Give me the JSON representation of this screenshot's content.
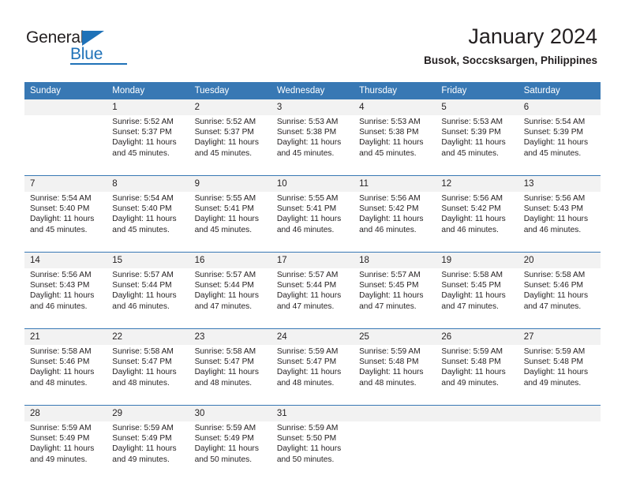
{
  "brand": {
    "name_part1": "General",
    "name_part2": "Blue",
    "triangle_icon": "triangle-icon",
    "accent_color": "#1f72b8"
  },
  "header": {
    "title": "January 2024",
    "subtitle": "Busok, Soccsksargen, Philippines"
  },
  "theme": {
    "header_bg": "#3878b4",
    "daynum_bg": "#f2f2f2",
    "cell_bg": "#ffffff",
    "text_color": "#231f20"
  },
  "calendar": {
    "weekday_headers": [
      "Sunday",
      "Monday",
      "Tuesday",
      "Wednesday",
      "Thursday",
      "Friday",
      "Saturday"
    ],
    "weeks": [
      {
        "daynums": [
          "",
          "1",
          "2",
          "3",
          "4",
          "5",
          "6"
        ],
        "details": [
          {
            "l1": "",
            "l2": "",
            "l3": "",
            "l4": ""
          },
          {
            "l1": "Sunrise: 5:52 AM",
            "l2": "Sunset: 5:37 PM",
            "l3": "Daylight: 11 hours",
            "l4": "and 45 minutes."
          },
          {
            "l1": "Sunrise: 5:52 AM",
            "l2": "Sunset: 5:37 PM",
            "l3": "Daylight: 11 hours",
            "l4": "and 45 minutes."
          },
          {
            "l1": "Sunrise: 5:53 AM",
            "l2": "Sunset: 5:38 PM",
            "l3": "Daylight: 11 hours",
            "l4": "and 45 minutes."
          },
          {
            "l1": "Sunrise: 5:53 AM",
            "l2": "Sunset: 5:38 PM",
            "l3": "Daylight: 11 hours",
            "l4": "and 45 minutes."
          },
          {
            "l1": "Sunrise: 5:53 AM",
            "l2": "Sunset: 5:39 PM",
            "l3": "Daylight: 11 hours",
            "l4": "and 45 minutes."
          },
          {
            "l1": "Sunrise: 5:54 AM",
            "l2": "Sunset: 5:39 PM",
            "l3": "Daylight: 11 hours",
            "l4": "and 45 minutes."
          }
        ]
      },
      {
        "daynums": [
          "7",
          "8",
          "9",
          "10",
          "11",
          "12",
          "13"
        ],
        "details": [
          {
            "l1": "Sunrise: 5:54 AM",
            "l2": "Sunset: 5:40 PM",
            "l3": "Daylight: 11 hours",
            "l4": "and 45 minutes."
          },
          {
            "l1": "Sunrise: 5:54 AM",
            "l2": "Sunset: 5:40 PM",
            "l3": "Daylight: 11 hours",
            "l4": "and 45 minutes."
          },
          {
            "l1": "Sunrise: 5:55 AM",
            "l2": "Sunset: 5:41 PM",
            "l3": "Daylight: 11 hours",
            "l4": "and 45 minutes."
          },
          {
            "l1": "Sunrise: 5:55 AM",
            "l2": "Sunset: 5:41 PM",
            "l3": "Daylight: 11 hours",
            "l4": "and 46 minutes."
          },
          {
            "l1": "Sunrise: 5:56 AM",
            "l2": "Sunset: 5:42 PM",
            "l3": "Daylight: 11 hours",
            "l4": "and 46 minutes."
          },
          {
            "l1": "Sunrise: 5:56 AM",
            "l2": "Sunset: 5:42 PM",
            "l3": "Daylight: 11 hours",
            "l4": "and 46 minutes."
          },
          {
            "l1": "Sunrise: 5:56 AM",
            "l2": "Sunset: 5:43 PM",
            "l3": "Daylight: 11 hours",
            "l4": "and 46 minutes."
          }
        ]
      },
      {
        "daynums": [
          "14",
          "15",
          "16",
          "17",
          "18",
          "19",
          "20"
        ],
        "details": [
          {
            "l1": "Sunrise: 5:56 AM",
            "l2": "Sunset: 5:43 PM",
            "l3": "Daylight: 11 hours",
            "l4": "and 46 minutes."
          },
          {
            "l1": "Sunrise: 5:57 AM",
            "l2": "Sunset: 5:44 PM",
            "l3": "Daylight: 11 hours",
            "l4": "and 46 minutes."
          },
          {
            "l1": "Sunrise: 5:57 AM",
            "l2": "Sunset: 5:44 PM",
            "l3": "Daylight: 11 hours",
            "l4": "and 47 minutes."
          },
          {
            "l1": "Sunrise: 5:57 AM",
            "l2": "Sunset: 5:44 PM",
            "l3": "Daylight: 11 hours",
            "l4": "and 47 minutes."
          },
          {
            "l1": "Sunrise: 5:57 AM",
            "l2": "Sunset: 5:45 PM",
            "l3": "Daylight: 11 hours",
            "l4": "and 47 minutes."
          },
          {
            "l1": "Sunrise: 5:58 AM",
            "l2": "Sunset: 5:45 PM",
            "l3": "Daylight: 11 hours",
            "l4": "and 47 minutes."
          },
          {
            "l1": "Sunrise: 5:58 AM",
            "l2": "Sunset: 5:46 PM",
            "l3": "Daylight: 11 hours",
            "l4": "and 47 minutes."
          }
        ]
      },
      {
        "daynums": [
          "21",
          "22",
          "23",
          "24",
          "25",
          "26",
          "27"
        ],
        "details": [
          {
            "l1": "Sunrise: 5:58 AM",
            "l2": "Sunset: 5:46 PM",
            "l3": "Daylight: 11 hours",
            "l4": "and 48 minutes."
          },
          {
            "l1": "Sunrise: 5:58 AM",
            "l2": "Sunset: 5:47 PM",
            "l3": "Daylight: 11 hours",
            "l4": "and 48 minutes."
          },
          {
            "l1": "Sunrise: 5:58 AM",
            "l2": "Sunset: 5:47 PM",
            "l3": "Daylight: 11 hours",
            "l4": "and 48 minutes."
          },
          {
            "l1": "Sunrise: 5:59 AM",
            "l2": "Sunset: 5:47 PM",
            "l3": "Daylight: 11 hours",
            "l4": "and 48 minutes."
          },
          {
            "l1": "Sunrise: 5:59 AM",
            "l2": "Sunset: 5:48 PM",
            "l3": "Daylight: 11 hours",
            "l4": "and 48 minutes."
          },
          {
            "l1": "Sunrise: 5:59 AM",
            "l2": "Sunset: 5:48 PM",
            "l3": "Daylight: 11 hours",
            "l4": "and 49 minutes."
          },
          {
            "l1": "Sunrise: 5:59 AM",
            "l2": "Sunset: 5:48 PM",
            "l3": "Daylight: 11 hours",
            "l4": "and 49 minutes."
          }
        ]
      },
      {
        "daynums": [
          "28",
          "29",
          "30",
          "31",
          "",
          "",
          ""
        ],
        "details": [
          {
            "l1": "Sunrise: 5:59 AM",
            "l2": "Sunset: 5:49 PM",
            "l3": "Daylight: 11 hours",
            "l4": "and 49 minutes."
          },
          {
            "l1": "Sunrise: 5:59 AM",
            "l2": "Sunset: 5:49 PM",
            "l3": "Daylight: 11 hours",
            "l4": "and 49 minutes."
          },
          {
            "l1": "Sunrise: 5:59 AM",
            "l2": "Sunset: 5:49 PM",
            "l3": "Daylight: 11 hours",
            "l4": "and 50 minutes."
          },
          {
            "l1": "Sunrise: 5:59 AM",
            "l2": "Sunset: 5:50 PM",
            "l3": "Daylight: 11 hours",
            "l4": "and 50 minutes."
          },
          {
            "l1": "",
            "l2": "",
            "l3": "",
            "l4": ""
          },
          {
            "l1": "",
            "l2": "",
            "l3": "",
            "l4": ""
          },
          {
            "l1": "",
            "l2": "",
            "l3": "",
            "l4": ""
          }
        ]
      }
    ]
  }
}
